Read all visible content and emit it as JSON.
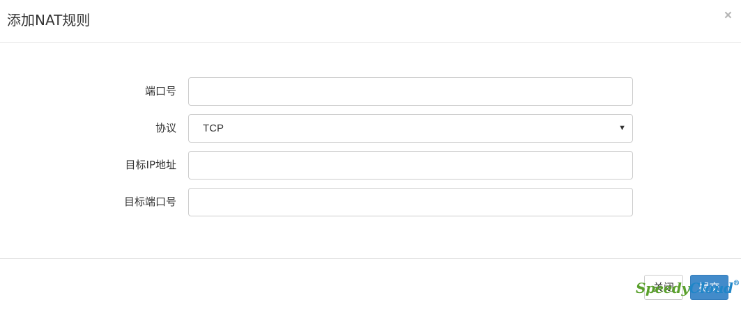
{
  "dialog": {
    "title": "添加NAT规则",
    "close_symbol": "×"
  },
  "form": {
    "port": {
      "label": "端口号",
      "value": ""
    },
    "protocol": {
      "label": "协议",
      "selected": "TCP",
      "arrow": "▼"
    },
    "target_ip": {
      "label": "目标IP地址",
      "value": ""
    },
    "target_port": {
      "label": "目标端口号",
      "value": ""
    }
  },
  "footer": {
    "close_label": "关闭",
    "submit_label": "提交"
  },
  "watermark": {
    "part1": "Speedy",
    "part2": "Cloud",
    "reg": "®"
  },
  "colors": {
    "primary": "#428bca",
    "border": "#cccccc",
    "watermark_green": "#5aa02c",
    "watermark_blue": "#1f86c8"
  }
}
